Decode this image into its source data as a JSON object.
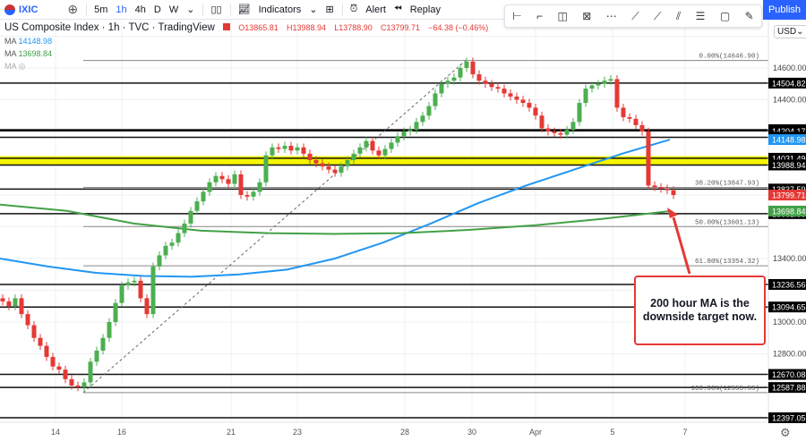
{
  "toolbar": {
    "symbol": "IXIC",
    "timeframes": [
      "5m",
      "1h",
      "4h",
      "D",
      "W"
    ],
    "active_tf": "1h",
    "indicators": "Indicators",
    "alert": "Alert",
    "replay": "Replay",
    "publish": "Publish",
    "currency": "USD"
  },
  "legend": {
    "title": "US Composite Index · 1h · TVC · TradingView",
    "open": "O13865.81",
    "high": "H13988.94",
    "low": "L13788.90",
    "close": "C13799.71",
    "change": "−64.38 (−0.46%)",
    "ma1_label": "MA",
    "ma1": "14148.98",
    "ma2_label": "MA",
    "ma2": "13698.84",
    "ma3_label": "MA"
  },
  "callout": {
    "line1": "200 hour MA is the",
    "line2": "downside target now."
  },
  "colors": {
    "up": "#26a69a",
    "up_candle": "#4caf50",
    "down": "#e53935",
    "ma100": "#2196f3",
    "ma200": "#43a047",
    "highlight": "#f5f500",
    "accent": "#2962ff"
  },
  "chart_data": {
    "type": "candlestick",
    "symbol": "IXIC",
    "interval": "1h",
    "ylim": [
      12360,
      14820
    ],
    "y_ticks": [
      "14600.00",
      "14400.00",
      "13400.00",
      "13000.00",
      "12800.00"
    ],
    "x_ticks": [
      "14",
      "16",
      "21",
      "23",
      "28",
      "30",
      "Apr",
      "5",
      "7"
    ],
    "closes": [
      13130,
      13100,
      13150,
      13050,
      12980,
      12900,
      12850,
      12780,
      12720,
      12700,
      12640,
      12600,
      12590,
      12620,
      12750,
      12820,
      12900,
      13000,
      13120,
      13230,
      13250,
      13260,
      13150,
      13050,
      13350,
      13420,
      13480,
      13500,
      13560,
      13620,
      13700,
      13760,
      13820,
      13880,
      13920,
      13900,
      13870,
      13930,
      13800,
      13790,
      13820,
      13880,
      14050,
      14100,
      14090,
      14110,
      14080,
      14100,
      14060,
      14020,
      14000,
      13980,
      13960,
      13940,
      13980,
      14020,
      14060,
      14100,
      14140,
      14080,
      14050,
      14090,
      14130,
      14170,
      14200,
      14210,
      14260,
      14300,
      14360,
      14440,
      14500,
      14520,
      14540,
      14600,
      14640,
      14560,
      14520,
      14500,
      14480,
      14470,
      14440,
      14420,
      14400,
      14380,
      14350,
      14300,
      14220,
      14200,
      14190,
      14180,
      14210,
      14260,
      14380,
      14470,
      14490,
      14500,
      14520,
      14530,
      14350,
      14290,
      14280,
      14240,
      14200,
      13860,
      13850,
      13840,
      13830,
      13800
    ],
    "ma100": [
      13400,
      13350,
      13310,
      13290,
      13285,
      13300,
      13330,
      13400,
      13500,
      13620,
      13750,
      13860,
      13960,
      14060,
      14148.98
    ],
    "ma200": [
      13740,
      13700,
      13620,
      13575,
      13560,
      13555,
      13560,
      13580,
      13610,
      13650,
      13698.84
    ],
    "levels": [
      {
        "value": 14504.82,
        "label": "14504.82"
      },
      {
        "value": 14211.57,
        "label": "14211.57"
      },
      {
        "value": 14204.17,
        "label": "14204.17"
      },
      {
        "value": 14163.73,
        "label": "14163.73"
      },
      {
        "value": 14031.49,
        "label": "14031.49"
      },
      {
        "value": 13988.94,
        "label": "13988.94"
      },
      {
        "value": 13837.59,
        "label": "13837.59"
      },
      {
        "value": 13682.55,
        "label": "13682.55"
      },
      {
        "value": 13236.56,
        "label": "13236.56"
      },
      {
        "value": 13094.65,
        "label": "13094.65"
      },
      {
        "value": 12670.08,
        "label": "12670.08"
      },
      {
        "value": 12587.88,
        "label": "12587.88"
      },
      {
        "value": 12397.05,
        "label": "12397.05"
      }
    ],
    "price_badges": [
      {
        "value": 14148.98,
        "label": "14148.98",
        "color": "#2196f3"
      },
      {
        "value": 13799.71,
        "label": "13799.71",
        "color": "#e53935"
      },
      {
        "value": 13698.84,
        "label": "13698.84",
        "color": "#43a047"
      }
    ],
    "fib": [
      {
        "value": 14646.9,
        "label": "0.00%(14646.90)"
      },
      {
        "value": 13847.93,
        "label": "38.20%(13847.93)"
      },
      {
        "value": 13601.13,
        "label": "50.00%(13601.13)"
      },
      {
        "value": 13354.32,
        "label": "61.80%(13354.32)"
      },
      {
        "value": 12555.55,
        "label": "100.00%(12555.55)"
      }
    ],
    "highlight_zone": [
      13990,
      14045
    ]
  }
}
